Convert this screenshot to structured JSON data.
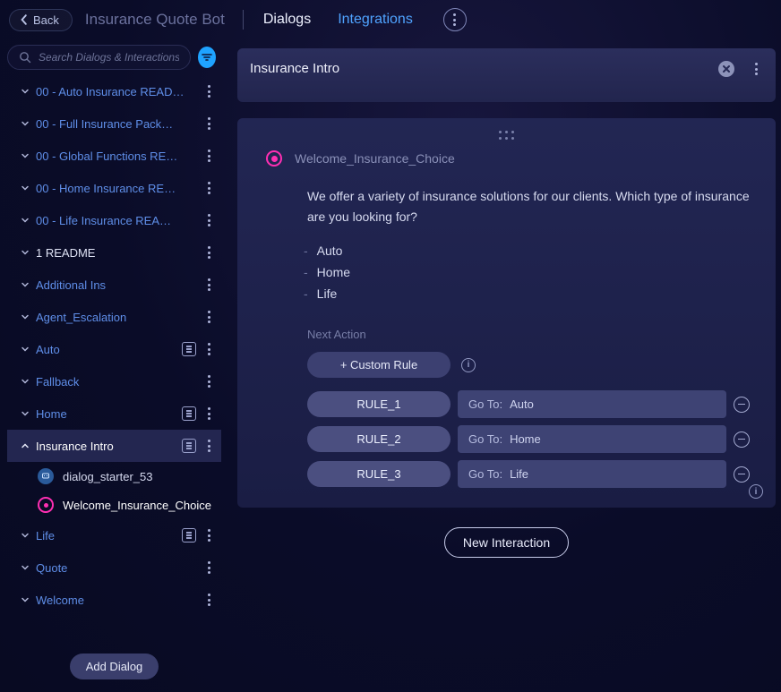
{
  "header": {
    "back_label": "Back",
    "app_title": "Insurance Quote Bot",
    "tabs": [
      {
        "label": "Dialogs",
        "active": true
      },
      {
        "label": "Integrations",
        "active": false
      }
    ]
  },
  "sidebar": {
    "search_placeholder": "Search Dialogs & Interactions",
    "items": [
      {
        "label": "00 - Auto Insurance READ…",
        "has_square": false
      },
      {
        "label": "00 - Full Insurance Pack…",
        "has_square": false
      },
      {
        "label": "00 - Global Functions RE…",
        "has_square": false
      },
      {
        "label": "00 - Home Insurance RE…",
        "has_square": false
      },
      {
        "label": "00 - Life Insurance REA…",
        "has_square": false
      },
      {
        "label": "1 README",
        "has_square": false,
        "white": true
      },
      {
        "label": "Additional Ins",
        "has_square": false
      },
      {
        "label": "Agent_Escalation",
        "has_square": false
      },
      {
        "label": "Auto",
        "has_square": true
      },
      {
        "label": "Fallback",
        "has_square": false
      },
      {
        "label": "Home",
        "has_square": true
      },
      {
        "label": "Insurance Intro",
        "has_square": true,
        "selected": true,
        "expanded": true,
        "children": [
          {
            "label": "dialog_starter_53",
            "icon": "blue"
          },
          {
            "label": "Welcome_Insurance_Choice",
            "icon": "magenta",
            "active": true
          }
        ]
      },
      {
        "label": "Life",
        "has_square": true
      },
      {
        "label": "Quote",
        "has_square": false
      },
      {
        "label": "Welcome",
        "has_square": false
      }
    ],
    "add_dialog_label": "Add Dialog"
  },
  "panel": {
    "title": "Insurance Intro"
  },
  "interaction": {
    "name": "Welcome_Insurance_Choice",
    "prompt": "We offer a variety of insurance solutions for our clients. Which type of insurance are you looking for?",
    "options": [
      "Auto",
      "Home",
      "Life"
    ],
    "next_action_label": "Next Action",
    "custom_rule_label": "+ Custom Rule",
    "go_to_label": "Go To:",
    "rules": [
      {
        "name": "RULE_1",
        "target": "Auto"
      },
      {
        "name": "RULE_2",
        "target": "Home"
      },
      {
        "name": "RULE_3",
        "target": "Life"
      }
    ]
  },
  "buttons": {
    "new_interaction": "New Interaction"
  }
}
